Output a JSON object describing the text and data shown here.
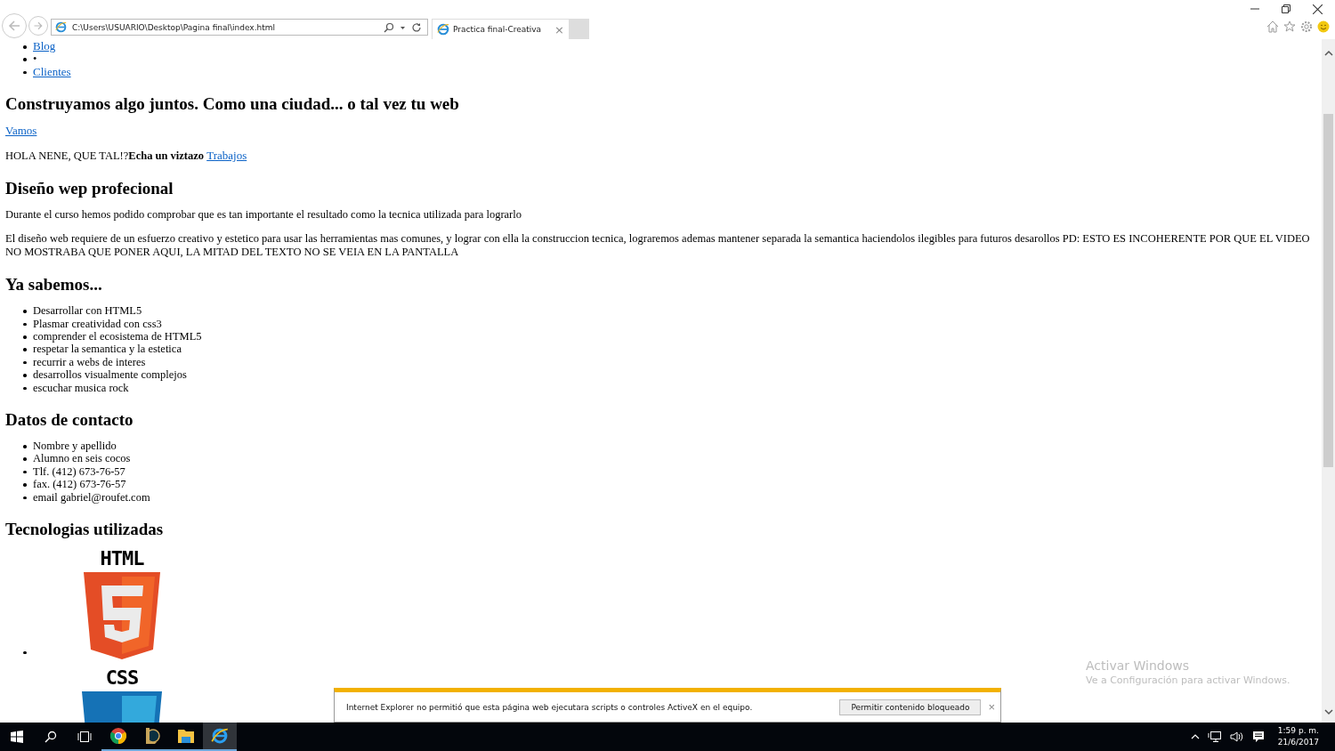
{
  "browser": {
    "address": "C:\\Users\\USUARIO\\Desktop\\Pagina final\\index.html",
    "tab": {
      "title": "Practica final-Creativa",
      "close": "×",
      "selected": true
    }
  },
  "page": {
    "nav_items": [
      {
        "text": "Blog",
        "link": true
      },
      {
        "text": "•",
        "link": false
      },
      {
        "text": "Clientes",
        "link": true
      }
    ],
    "hero_heading": "Construyamos algo juntos. Como una ciudad... o tal vez tu web",
    "hero_link": "Vamos",
    "greeting": {
      "text": "HOLA NENE, QUE TAL!?**Echa un viztazo**",
      "link": "Trabajos"
    },
    "sections": [
      {
        "heading": "Diseño wep profecional",
        "kind": "paragraphs",
        "items": [
          "Durante el curso hemos podido comprobar que es tan importante el resultado como la tecnica utilizada para lograrlo",
          "El diseño web requiere de un esfuerzo creativo y estetico para usar las herramientas mas comunes, y lograr con ella la construccion tecnica, lograremos ademas mantener separada la semantica haciendolos ilegibles para futuros desarollos PD: ESTO ES INCOHERENTE POR QUE EL VIDEO NO MOSTRABA QUE PONER AQUI, LA MITAD DEL TEXTO NO SE VEIA EN LA PANTALLA"
        ]
      },
      {
        "heading": "Ya sabemos...",
        "kind": "list",
        "items": [
          "Desarrollar con HTML5",
          "Plasmar creatividad con css3",
          "comprender el ecosistema de HTML5",
          "respetar la semantica y la estetica",
          "recurrir a webs de interes",
          "desarrollos visualmente complejos",
          "escuchar musica rock"
        ]
      },
      {
        "heading": "Datos de contacto",
        "kind": "list",
        "items": [
          "Nombre y apellido",
          "Alumno en seis cocos",
          "Tlf. (412) 673-76-57",
          "fax. (412) 673-76-57",
          "email gabriel@roufet.com"
        ]
      },
      {
        "heading": "Tecnologias utilizadas",
        "kind": "logos"
      }
    ],
    "logos": [
      {
        "kind": "html",
        "label": "HTML"
      },
      {
        "kind": "css",
        "label": "CSS"
      }
    ]
  },
  "infobar": {
    "message": "Internet Explorer no permitió que esta página web ejecutara scripts o controles ActiveX en el equipo.",
    "button": "Permitir contenido bloqueado",
    "close": "×"
  },
  "activation": {
    "title": "Activar Windows",
    "subtitle": "Ve a Configuración para activar Windows."
  },
  "taskbar": {
    "apps": [
      {
        "kind": "chrome",
        "open": true,
        "selected": false
      },
      {
        "kind": "game",
        "open": true,
        "selected": false
      },
      {
        "kind": "folder",
        "open": true,
        "selected": false
      },
      {
        "kind": "ie",
        "open": true,
        "selected": true
      }
    ],
    "time": "1:59 p. m.",
    "date": "21/6/2017"
  }
}
